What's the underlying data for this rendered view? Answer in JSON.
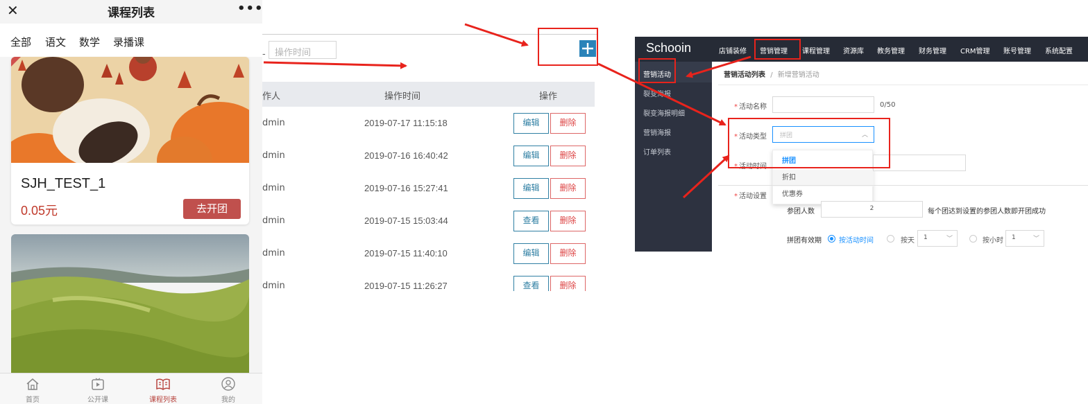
{
  "mobile": {
    "title": "课程列表",
    "close_icon": "close-icon",
    "more_label": "•••",
    "tabs": [
      "全部",
      "语文",
      "数学",
      "录播课"
    ],
    "course": {
      "name": "SJH_TEST_1",
      "price": "0.05元",
      "action": "去开团"
    },
    "tabbar": [
      {
        "label": "首页",
        "icon": "home-icon",
        "active": false
      },
      {
        "label": "公开课",
        "icon": "video-icon",
        "active": false
      },
      {
        "label": "课程列表",
        "icon": "book-icon",
        "active": true
      },
      {
        "label": "我的",
        "icon": "user-icon",
        "active": false
      }
    ],
    "colors": {
      "price": "#c0392b",
      "button": "#c0504d",
      "active_tab": "#b8443e"
    }
  },
  "table_panel": {
    "dash": "-",
    "date_placeholder": "操作时间",
    "add_icon": "plus-icon",
    "headers": [
      "作人",
      "操作时间",
      "操作"
    ],
    "rows": [
      {
        "user": "dmin",
        "time": "2019-07-17 11:15:18",
        "primary": "编辑",
        "danger": "删除"
      },
      {
        "user": "dmin",
        "time": "2019-07-16 16:40:42",
        "primary": "编辑",
        "danger": "删除"
      },
      {
        "user": "dmin",
        "time": "2019-07-16 15:27:41",
        "primary": "编辑",
        "danger": "删除"
      },
      {
        "user": "dmin",
        "time": "2019-07-15 15:03:44",
        "primary": "查看",
        "danger": "删除"
      },
      {
        "user": "dmin",
        "time": "2019-07-15 11:40:10",
        "primary": "编辑",
        "danger": "删除"
      },
      {
        "user": "dmin",
        "time": "2019-07-15 11:26:27",
        "primary": "查看",
        "danger": "删除"
      }
    ],
    "colors": {
      "add_button": "#2a83b9",
      "primary": "#2f7fa3",
      "danger": "#dd4444"
    }
  },
  "admin": {
    "logo": "Schooin",
    "nav": [
      "店铺装修",
      "营销管理",
      "课程管理",
      "资源库",
      "教务管理",
      "财务管理",
      "CRM管理",
      "账号管理",
      "系统配置"
    ],
    "sidebar": [
      "营销活动",
      "裂变海报",
      "裂变海报明细",
      "营销海报",
      "订单列表"
    ],
    "breadcrumb": {
      "parent": "营销活动列表",
      "separator": "/",
      "current": "新增营销活动"
    },
    "form": {
      "name_label": "活动名称",
      "name_counter": "0/50",
      "type_label": "活动类型",
      "type_placeholder": "拼团",
      "type_options": [
        "拼团",
        "折扣",
        "优惠券"
      ],
      "time_label": "活动时间",
      "settings_label": "活动设置",
      "group_size_label": "参团人数",
      "group_size_value": "2",
      "group_size_hint": "每个团达到设置的参团人数即开团成功",
      "validity_label": "拼团有效期",
      "validity_options": [
        "按活动时间",
        "按天",
        "按小时"
      ],
      "day_value": "1",
      "hour_value": "1",
      "required_mark": "*"
    },
    "colors": {
      "topbar": "#262b36",
      "sidebar": "#2d3240",
      "highlight": "#1890ff"
    }
  },
  "annotations": {
    "color": "#e8231c"
  }
}
